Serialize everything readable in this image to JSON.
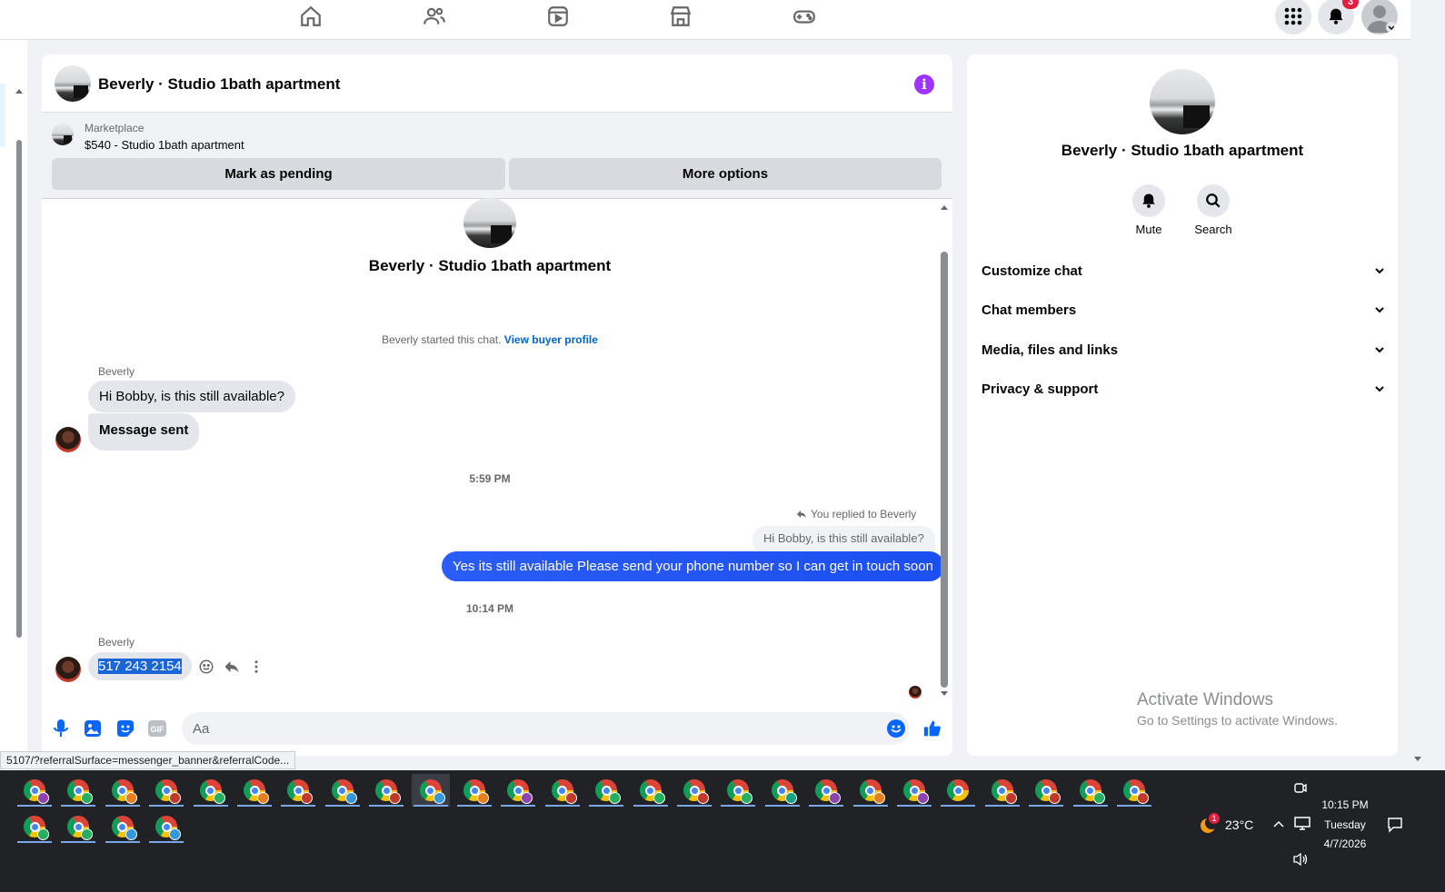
{
  "topbar": {
    "nav": [
      "home-icon",
      "friends-icon",
      "watch-icon",
      "marketplace-icon",
      "gaming-icon"
    ],
    "notification_count": "3"
  },
  "chat": {
    "title": "Beverly · Studio 1bath apartment",
    "marketplace": {
      "label": "Marketplace",
      "listing": "$540 - Studio 1bath apartment",
      "mark_pending": "Mark as pending",
      "more_options": "More options"
    },
    "intro_title": "Beverly · Studio 1bath apartment",
    "system_text": "Beverly started this chat.",
    "system_link": "View buyer profile",
    "sender_1": "Beverly",
    "msg_1": "Hi Bobby, is this still available?",
    "msg_2": "Message sent",
    "time_1": "5:59 PM",
    "replied_label": "You replied to Beverly",
    "quoted": "Hi Bobby, is this still available?",
    "msg_out": "Yes its still available Please send your phone number so I can get in touch soon",
    "time_2": "10:14 PM",
    "sender_2": "Beverly",
    "msg_phone": "517 243 2154",
    "composer_placeholder": "Aa"
  },
  "status_url": "5107/?referralSurface=messenger_banner&referralCode...",
  "right_panel": {
    "title": "Beverly · Studio 1bath apartment",
    "mute": "Mute",
    "search": "Search",
    "sections": [
      "Customize chat",
      "Chat members",
      "Media, files and links",
      "Privacy & support"
    ],
    "activate_title": "Activate Windows",
    "activate_sub": "Go to Settings to activate Windows."
  },
  "taskbar": {
    "weather_temp": "23°C",
    "weather_badge": "1",
    "time": "10:15 PM",
    "day": "Tuesday",
    "date": "4/7/2026",
    "profile_colors_row1": [
      "#8e44ad",
      "#27ae60",
      "#e67e22",
      "#c0392b",
      "#27ae60",
      "#e67e22",
      "#c0392b",
      "#3498db",
      "#c0392b",
      "#3498db",
      "#e67e22",
      "#8e44ad",
      "#c0392b",
      "#27ae60",
      "#27ae60",
      "#c0392b",
      "#27ae60",
      "#16a085",
      "#8e44ad",
      "#e67e22",
      "#8e44ad",
      "",
      "#c0392b",
      "#c0392b",
      "#27ae60",
      "#c0392b"
    ],
    "profile_colors_row2": [
      "#27ae60",
      "#27ae60",
      "#3498db",
      "#3498db"
    ]
  },
  "colors": {
    "accent_blue": "#0064d1",
    "outgoing_bubble": "#2a5cf7",
    "info_purple": "#a033ff",
    "badge_red": "#e41e3f"
  }
}
